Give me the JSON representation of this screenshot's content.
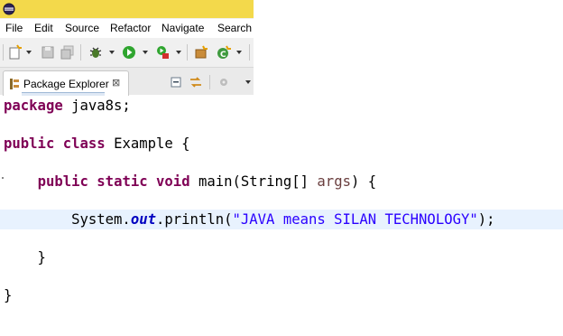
{
  "menubar": {
    "file": "File",
    "edit": "Edit",
    "source": "Source",
    "refactor": "Refactor",
    "navigate": "Navigate",
    "search": "Search"
  },
  "toolbar": {
    "icons": [
      "new-icon",
      "save-icon",
      "save-all-icon",
      "debug-icon",
      "run-icon",
      "external-tools-icon",
      "new-package-icon",
      "new-class-icon"
    ]
  },
  "view": {
    "tab_label": "Package Explorer",
    "close_glyph": "⊠"
  },
  "editor": {
    "lines": [
      {
        "tokens": [
          {
            "t": "package",
            "c": "kw"
          },
          {
            "t": " java8s;",
            "c": ""
          }
        ]
      },
      {
        "tokens": [
          {
            "t": "public",
            "c": "kw"
          },
          {
            "t": " ",
            "c": ""
          },
          {
            "t": "class",
            "c": "kw"
          },
          {
            "t": " Example {",
            "c": ""
          }
        ]
      },
      {
        "tokens": [
          {
            "t": "    ",
            "c": ""
          },
          {
            "t": "public",
            "c": "kw"
          },
          {
            "t": " ",
            "c": ""
          },
          {
            "t": "static",
            "c": "kw"
          },
          {
            "t": " ",
            "c": ""
          },
          {
            "t": "void",
            "c": "kw"
          },
          {
            "t": " main(String[] ",
            "c": ""
          },
          {
            "t": "args",
            "c": "arg"
          },
          {
            "t": ") {",
            "c": ""
          }
        ]
      },
      {
        "tokens": [
          {
            "t": "        System.",
            "c": ""
          },
          {
            "t": "out",
            "c": "fld"
          },
          {
            "t": ".println(",
            "c": ""
          },
          {
            "t": "\"JAVA means SILAN TECHNOLOGY\"",
            "c": "str"
          },
          {
            "t": ");",
            "c": ""
          }
        ]
      },
      {
        "tokens": [
          {
            "t": "    }",
            "c": ""
          }
        ]
      },
      {
        "tokens": [
          {
            "t": "}",
            "c": ""
          }
        ]
      }
    ]
  },
  "colors": {
    "keyword": "#7f0055",
    "string": "#2a00ff",
    "static_field": "#0000c0",
    "current_line": "#e8f2fe",
    "titlebar": "#f3d94b"
  }
}
